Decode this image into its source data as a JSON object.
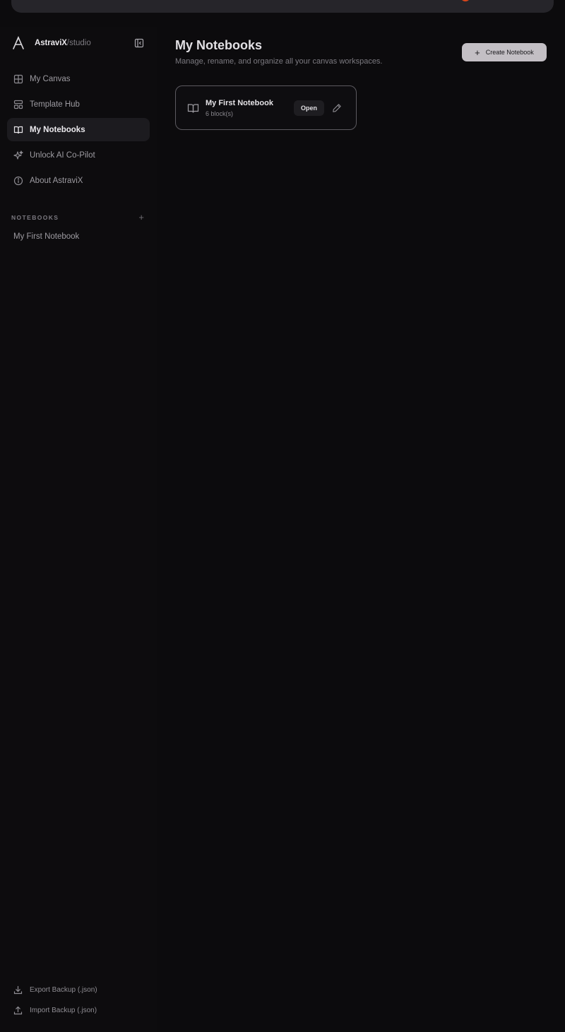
{
  "brand": {
    "name": "AstraviX",
    "suffix": "/studio"
  },
  "sidebar": {
    "items": [
      {
        "label": "My Canvas",
        "icon": "grid-icon",
        "active": false
      },
      {
        "label": "Template Hub",
        "icon": "layout-template-icon",
        "active": false
      },
      {
        "label": "My Notebooks",
        "icon": "book-open-icon",
        "active": true
      },
      {
        "label": "Unlock AI Co-Pilot",
        "icon": "sparkles-icon",
        "active": false
      },
      {
        "label": "About AstraviX",
        "icon": "info-icon",
        "active": false
      }
    ],
    "notebooks_heading": "NOTEBOOKS",
    "notebooks": [
      {
        "label": "My First Notebook"
      }
    ],
    "footer": {
      "export_label": "Export Backup (.json)",
      "import_label": "Import Backup (.json)"
    }
  },
  "main": {
    "title": "My Notebooks",
    "subtitle": "Manage, rename, and organize all your canvas workspaces.",
    "create_label": "Create Notebook",
    "cards": [
      {
        "title": "My First Notebook",
        "meta": "6 block(s)",
        "open_label": "Open"
      }
    ]
  },
  "colors": {
    "background": "#0c0b0d",
    "active_item": "#1c1b1f",
    "create_button": "#c3bfc4",
    "accent_flame": "#d9461b"
  }
}
